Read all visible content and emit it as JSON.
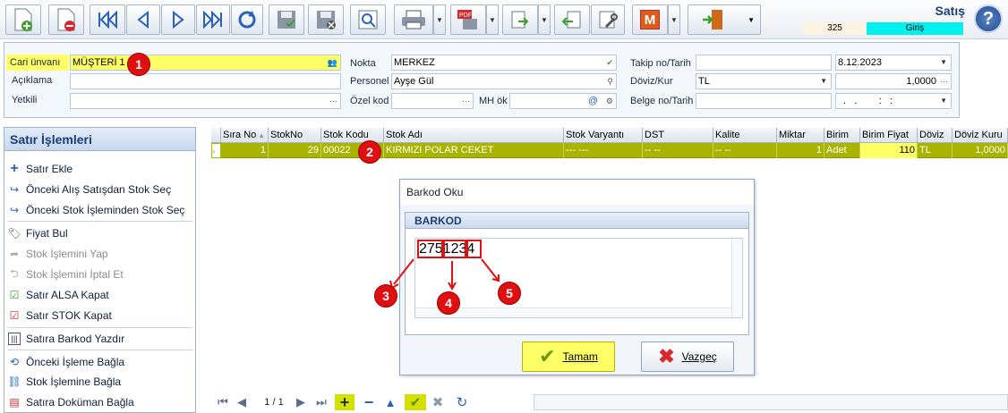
{
  "header": {
    "title": "Satış",
    "doc_number": "325",
    "mode": "Giriş",
    "help": "?"
  },
  "toolbar": {
    "icons": [
      "new-document-icon",
      "delete-document-icon",
      "first-record-icon",
      "previous-record-icon",
      "next-record-icon",
      "last-record-icon",
      "refresh-icon",
      "save-icon",
      "save-close-icon",
      "preview-icon",
      "print-icon",
      "pdf-icon",
      "export-icon",
      "import-icon",
      "tools-icon",
      "m-icon",
      "exit-icon"
    ],
    "m_label": "M"
  },
  "form": {
    "cari_label": "Cari ünvanı",
    "cari_value": "MÜŞTERİ 1",
    "aciklama_label": "Açıklama",
    "yetkili_label": "Yetkili",
    "nokta_label": "Nokta",
    "nokta_value": "MERKEZ",
    "personel_label": "Personel",
    "personel_value": "Ayşe Gül",
    "ozel_kod_label": "Özel kod",
    "mh_ok_label": "MH ök",
    "takip_label": "Takip no/Tarih",
    "takip_date": "8.12.2023",
    "doviz_label": "Döviz/Kur",
    "doviz_value": "TL",
    "kur_value": "1,0000",
    "belge_label": "Belge no/Tarih",
    "belge_date": ".   .        :   :"
  },
  "left_panel": {
    "title": "Satır İşlemleri",
    "items": [
      {
        "label": "Satır Ekle",
        "enabled": true
      },
      {
        "label": "Önceki Alış Satışdan Stok Seç",
        "enabled": true
      },
      {
        "label": "Önceki Stok İşleminden Stok Seç",
        "enabled": true
      },
      {
        "label": "Fiyat Bul",
        "enabled": true
      },
      {
        "label": "Stok İşlemini Yap",
        "enabled": false
      },
      {
        "label": "Stok İşlemini İptal Et",
        "enabled": false
      },
      {
        "label": "Satır ALSA Kapat",
        "enabled": true
      },
      {
        "label": "Satır STOK Kapat",
        "enabled": true
      },
      {
        "label": "Satıra Barkod Yazdır",
        "enabled": true
      },
      {
        "label": "Önceki İşleme Bağla",
        "enabled": true
      },
      {
        "label": "Stok İşlemine Bağla",
        "enabled": true
      },
      {
        "label": "Satıra Doküman Bağla",
        "enabled": true
      }
    ]
  },
  "grid": {
    "columns": [
      "Sıra No",
      "StokNo",
      "Stok Kodu",
      "Stok Adı",
      "Stok Varyantı",
      "DST",
      "Kalite",
      "Miktar",
      "Birim",
      "Birim Fiyat",
      "Döviz",
      "Döviz Kuru"
    ],
    "row": {
      "sira_no": "1",
      "stok_no": "29",
      "stok_kodu": "00022",
      "stok_adi": "KIRMIZI POLAR CEKET",
      "stok_varyanti": "--- ---",
      "dst": "-- --",
      "kalite": "-- --",
      "miktar": "1",
      "birim": "Adet",
      "birim_fiyat": "110",
      "doviz": "TL",
      "doviz_kuru": "1,0000"
    }
  },
  "nav": {
    "page": "1 / 1"
  },
  "dialog": {
    "title": "Barkod Oku",
    "group_title": "BARKOD",
    "barcode_part1": "275",
    "barcode_part2": "123",
    "barcode_part3": "4",
    "ok_label": "Tamam",
    "cancel_label": "Vazgeç"
  },
  "annotations": [
    "1",
    "2",
    "3",
    "4",
    "5"
  ],
  "colors": {
    "row_highlight": "#a8b400",
    "cari_highlight": "#ffff66",
    "badge": "#e01010",
    "cyan": "#00f0f0"
  }
}
